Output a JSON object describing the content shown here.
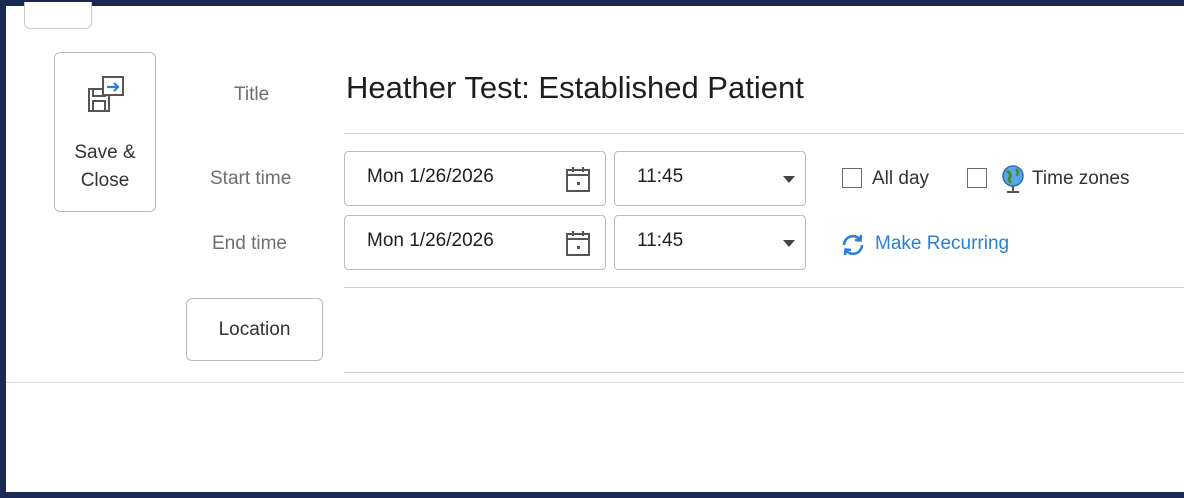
{
  "toolbar": {
    "save_close_label": "Save &\nClose"
  },
  "form": {
    "title_label": "Title",
    "title_value": "Heather Test: Established Patient",
    "start_label": "Start time",
    "start_date": "Mon 1/26/2026",
    "start_time": "11:45",
    "end_label": "End time",
    "end_date": "Mon 1/26/2026",
    "end_time": "11:45",
    "all_day_label": "All day",
    "time_zones_label": "Time zones",
    "make_recurring_label": "Make Recurring",
    "location_button_label": "Location"
  },
  "icons": {
    "save_close": "save-close-icon",
    "calendar": "calendar-icon",
    "globe": "globe-icon",
    "recurring": "recurring-icon",
    "dropdown": "chevron-down-icon"
  },
  "colors": {
    "frame_border": "#1b2a55",
    "link": "#2a7fd4",
    "label_gray": "#6e6e6e"
  }
}
